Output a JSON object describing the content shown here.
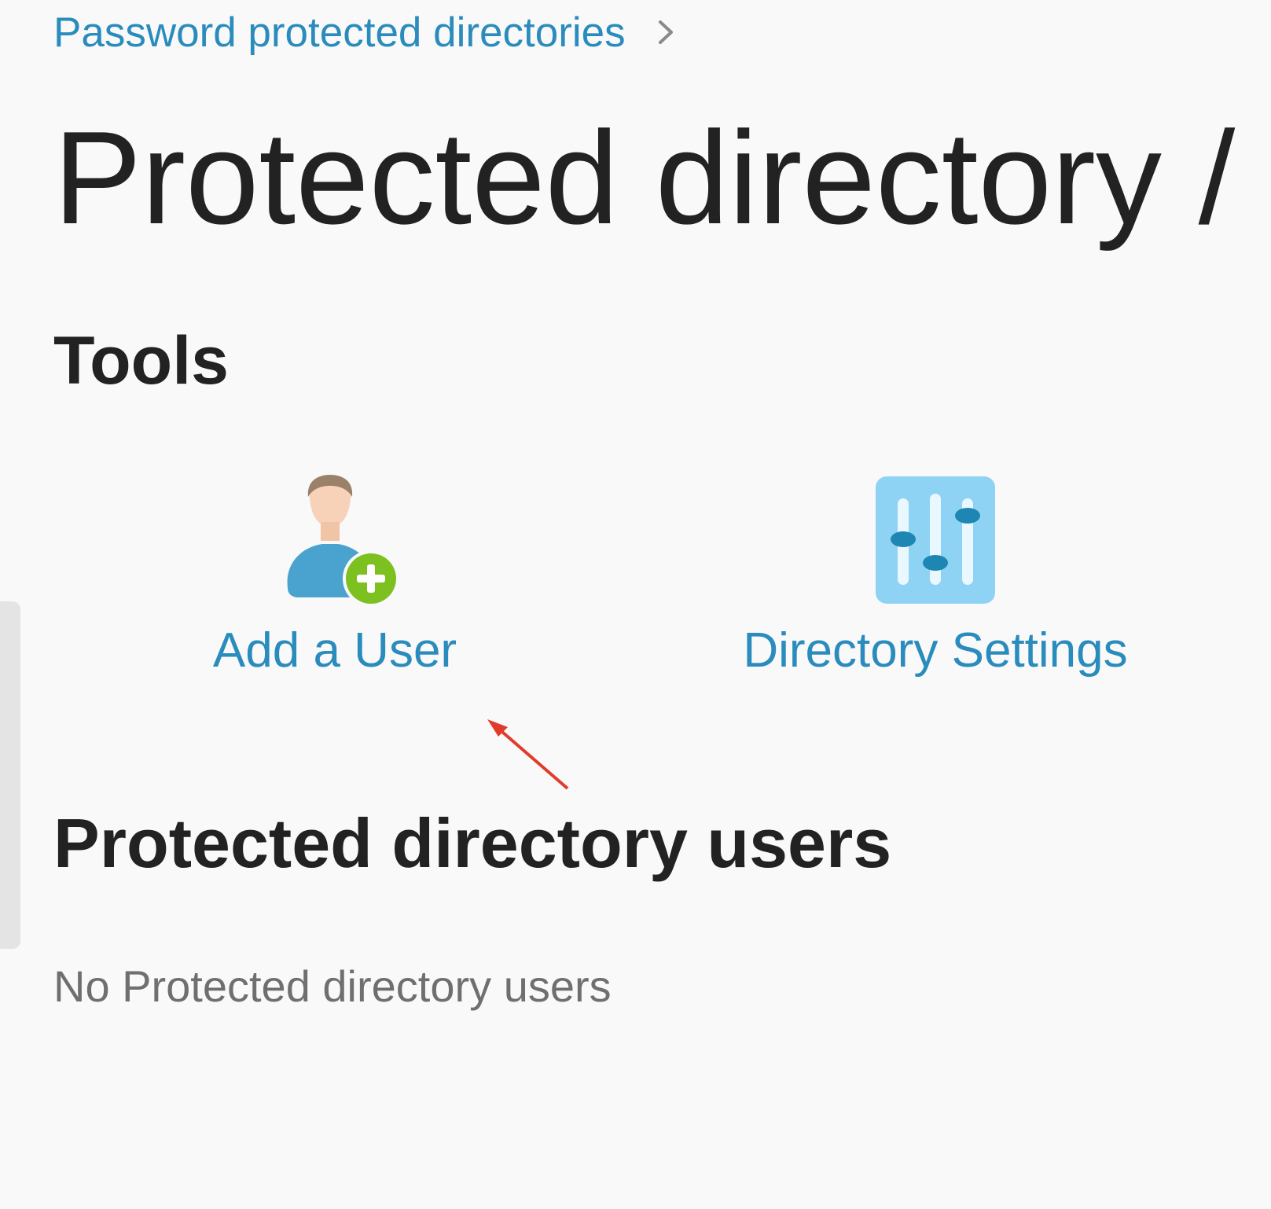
{
  "breadcrumb": {
    "link_label": "Password protected directories",
    "separator_icon": "chevron-right-icon"
  },
  "page": {
    "title": "Protected directory /"
  },
  "tools": {
    "heading": "Tools",
    "items": [
      {
        "label": "Add a User",
        "icon": "add-user-icon"
      },
      {
        "label": "Directory Settings",
        "icon": "sliders-settings-icon"
      }
    ]
  },
  "users": {
    "heading": "Protected directory users",
    "empty_message": "No Protected directory users"
  },
  "colors": {
    "link": "#2a8bbd",
    "text": "#222222",
    "muted": "#6f6f6f",
    "background": "#f9f9f9",
    "user_body": "#4aa3cf",
    "add_badge": "#7cc11f",
    "settings_tile": "#8fd3f4",
    "annotation_arrow": "#e23b2e"
  }
}
